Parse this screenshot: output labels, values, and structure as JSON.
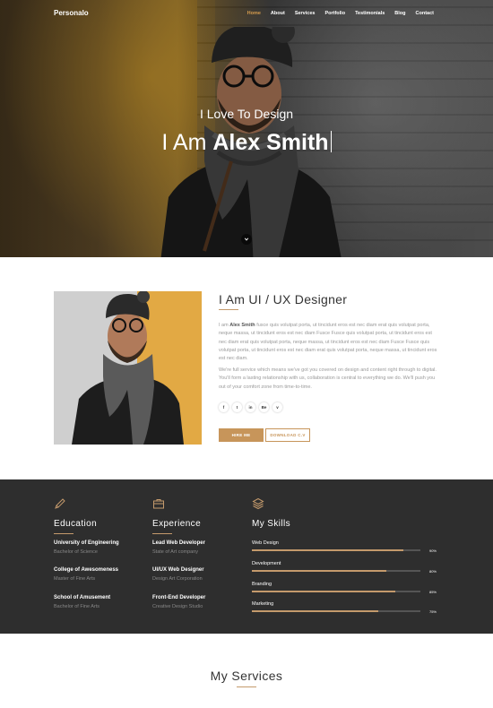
{
  "nav": {
    "logo": "Personalo",
    "items": [
      {
        "label": "Home",
        "active": true
      },
      {
        "label": "About"
      },
      {
        "label": "Services"
      },
      {
        "label": "Portfolio"
      },
      {
        "label": "Testimonials"
      },
      {
        "label": "Blog"
      },
      {
        "label": "Contact"
      }
    ]
  },
  "hero": {
    "subtitle": "I Love To Design",
    "title_prefix": "I Am ",
    "title_name": "Alex Smith"
  },
  "about": {
    "heading": "I Am UI / UX Designer",
    "p1_lead": "I am ",
    "p1_name": "Alex Smith",
    "p1_rest": " fusce quis volutpat porta, ut tincidunt eros est nec diam erat quis volutpat porta, neque massa, ut tincidunt eros est nec diam Fusce Fusce quis volutpat porta, ut tincidunt eros est nec diam erat quis volutpat porta, neque massa, ut tincidunt eros est nec diam Fusce Fusce quis volutpat porta, ut tincidunt eros est nec diam erat quis volutpat porta, neque massa, ut tincidunt eros est nec diam.",
    "p2": "We're full service which means we've got you covered on design and content right through to digital. You'll form a lasting relationship with us, collaboration is central to everything we do. We'll push you out of your comfort zone from time-to-time.",
    "socials": [
      "f",
      "t",
      "in",
      "Be",
      "v"
    ],
    "hire_label": "HIRE ME",
    "cv_label": "DOWNLOAD C.V"
  },
  "education": {
    "title": "Education",
    "items": [
      {
        "title": "University of Engineering",
        "sub": "Bachelor of Science"
      },
      {
        "title": "College of Awesomeness",
        "sub": "Master of Fine Arts"
      },
      {
        "title": "School of Amusement",
        "sub": "Bachelor of Fine Arts"
      }
    ]
  },
  "experience": {
    "title": "Experience",
    "items": [
      {
        "title": "Lead Web Developer",
        "sub": "State of Art company"
      },
      {
        "title": "UI/UX Web Designer",
        "sub": "Design Art Corporation"
      },
      {
        "title": "Front-End Developer",
        "sub": "Creative Design Studio"
      }
    ]
  },
  "skills": {
    "title": "My Skills",
    "items": [
      {
        "name": "Web Design",
        "percent": 90,
        "label": "90%"
      },
      {
        "name": "Development",
        "percent": 80,
        "label": "80%"
      },
      {
        "name": "Branding",
        "percent": 85,
        "label": "85%"
      },
      {
        "name": "Marketing",
        "percent": 75,
        "label": "75%"
      }
    ]
  },
  "services": {
    "heading": "My Services"
  },
  "colors": {
    "accent": "#c7955a",
    "dark_section": "#2e2e2e"
  }
}
